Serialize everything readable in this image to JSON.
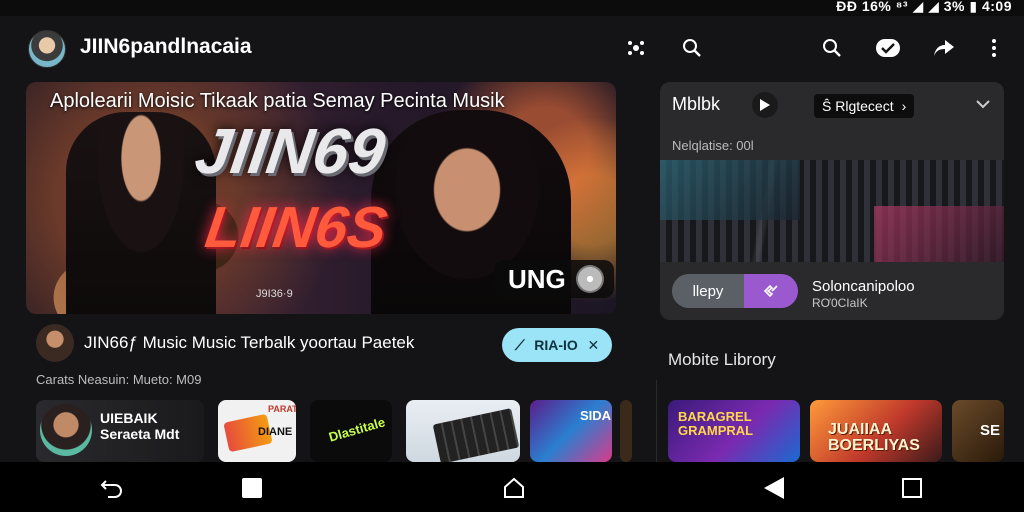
{
  "status_bar": {
    "text": "ÐÐ 16% ⁸³ ◢ ◢ 3% ▮ 4:09"
  },
  "header": {
    "title": "JIIN6pandlnacaia",
    "icons": [
      "network-icon",
      "search-icon",
      "search-icon",
      "checkmark-badge-icon",
      "share-icon",
      "more-vert-icon"
    ]
  },
  "hero": {
    "caption": "Aplolearii Moisic Tikaak patia Semay Pecinta Musik",
    "logo_line1": "JIIN69",
    "logo_line2": "LIIN6S",
    "small_text": "J9I36·9",
    "badge_text": "UNG"
  },
  "now_playing_card": {
    "title": "Mblbk",
    "chip_label": "Ŝ Rlgtecect",
    "subtitle": "Nelqlatise: 00l",
    "toggle_left": "llepy",
    "artist_name": "Soloncanipoloo",
    "artist_meta": "RƠ0CIaIK"
  },
  "track": {
    "title": "JIN66ƒ Music Music Terbalk yoortau Paetek",
    "subtitle": "Carats Neasuin: Mueto: M09",
    "action_labels": [
      "⟋",
      "RIA-IO",
      "✕"
    ]
  },
  "library": {
    "title": "Mobite Librory"
  },
  "thumbnails": [
    {
      "title_line1": "UIEBAIK",
      "title_line2": "Seraeta Mdt"
    },
    {
      "tag": "PARAT",
      "title": "DIANE"
    },
    {
      "title": "Dlastitale"
    },
    {
      "title": ""
    },
    {
      "title": "SIDA"
    },
    {
      "title": ""
    },
    {
      "title_line1": "BARAGREL",
      "title_line2": "GRAMPRAL"
    },
    {
      "title_line1": "JUAIIAA",
      "title_line2": "BOERLIYAS"
    },
    {
      "title": "SE"
    }
  ],
  "navbar": {
    "icons": [
      "back-icon",
      "stop-square-icon",
      "home-icon",
      "triangle-back-icon",
      "recent-apps-icon"
    ]
  },
  "colors": {
    "background": "#141416",
    "card": "#2a2a2d",
    "accent_cyan": "#9be3f6",
    "accent_purple": "#9b59d0"
  }
}
